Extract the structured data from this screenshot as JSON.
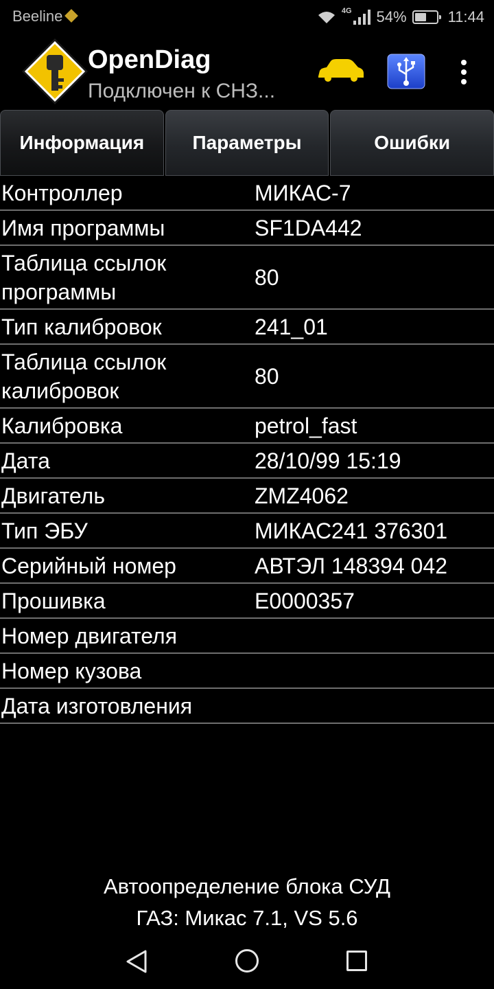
{
  "status_bar": {
    "carrier": "Beeline",
    "network": "4G",
    "battery": "54%",
    "battery_level": 0.54,
    "time": "11:44"
  },
  "app_bar": {
    "title": "OpenDiag",
    "subtitle": "Подключен к СНЗ..."
  },
  "tabs": [
    {
      "label": "Информация",
      "active": true
    },
    {
      "label": "Параметры",
      "active": false
    },
    {
      "label": "Ошибки",
      "active": false
    }
  ],
  "info_rows": [
    {
      "label": "Контроллер",
      "value": "МИКАС-7"
    },
    {
      "label": "Имя программы",
      "value": "SF1DA442"
    },
    {
      "label": "Таблица ссылок программы",
      "value": "80"
    },
    {
      "label": "Тип калибровок",
      "value": "241_01"
    },
    {
      "label": "Таблица ссылок калибровок",
      "value": "80"
    },
    {
      "label": "Калибровка",
      "value": "petrol_fast"
    },
    {
      "label": "Дата",
      "value": "28/10/99 15:19"
    },
    {
      "label": "Двигатель",
      "value": "ZMZ4062"
    },
    {
      "label": "Тип ЭБУ",
      "value": "МИКАС241 376301"
    },
    {
      "label": "Серийный номер",
      "value": "АВТЭЛ 148394 042"
    },
    {
      "label": "Прошивка",
      "value": "E0000357"
    },
    {
      "label": "Номер двигателя",
      "value": ""
    },
    {
      "label": "Номер кузова",
      "value": ""
    },
    {
      "label": "Дата изготовления",
      "value": ""
    }
  ],
  "footer": {
    "line1": "Автоопределение блока СУД",
    "line2": "ГАЗ: Микас 7.1, VS 5.6"
  },
  "icons": {
    "logo": "key-logo-icon",
    "car": "car-icon",
    "usb": "usb-icon",
    "menu": "more-vert-icon"
  },
  "colors": {
    "background": "#000000",
    "logo_yellow": "#f2c200",
    "car_yellow": "#f5d000",
    "usb_blue": "#2f5fe0",
    "divider": "#6e6e6e"
  }
}
